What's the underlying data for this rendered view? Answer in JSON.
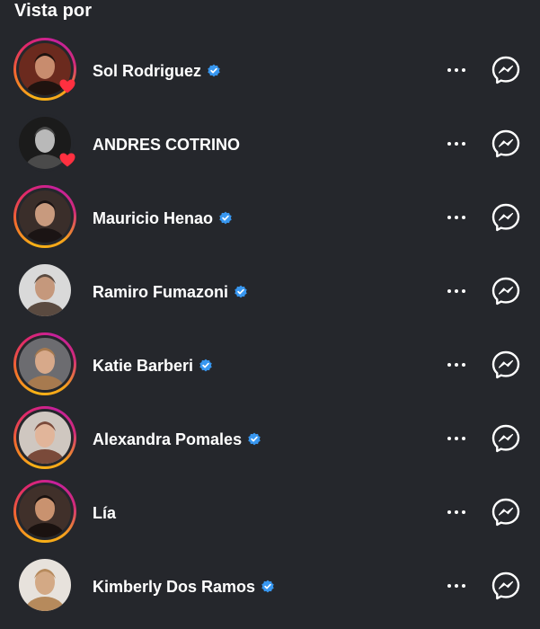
{
  "header": {
    "title": "Vista por"
  },
  "icons": {
    "more": "more-horizontal-icon",
    "message": "messenger-icon",
    "verified": "verified-badge-icon",
    "liked": "heart-icon"
  },
  "colors": {
    "background": "#25272c",
    "verified_blue": "#3897f0",
    "heart_red": "#ff3040",
    "ring_start": "#f9b316",
    "ring_end": "#c5209c"
  },
  "viewers": [
    {
      "name": "Sol Rodriguez",
      "verified": true,
      "story_ring": true,
      "liked": true
    },
    {
      "name": "ANDRES COTRINO",
      "verified": false,
      "story_ring": false,
      "liked": true
    },
    {
      "name": "Mauricio Henao",
      "verified": true,
      "story_ring": true,
      "liked": false
    },
    {
      "name": "Ramiro Fumazoni",
      "verified": true,
      "story_ring": false,
      "liked": false
    },
    {
      "name": "Katie Barberi",
      "verified": true,
      "story_ring": true,
      "liked": false
    },
    {
      "name": "Alexandra Pomales",
      "verified": true,
      "story_ring": true,
      "liked": false
    },
    {
      "name": "Lía",
      "verified": false,
      "story_ring": true,
      "liked": false
    },
    {
      "name": "Kimberly Dos Ramos",
      "verified": true,
      "story_ring": false,
      "liked": false
    }
  ]
}
